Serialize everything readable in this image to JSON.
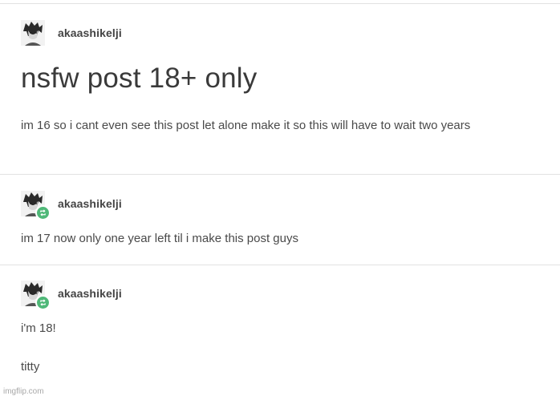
{
  "posts": [
    {
      "username": "akaashikelji",
      "title": "nsfw post 18+ only",
      "body": "im 16 so i cant even see this post let alone make it so this will have to wait two years",
      "reblogged": false
    },
    {
      "username": "akaashikelji",
      "body": "im 17 now only one year left til i make this post guys",
      "reblogged": true
    },
    {
      "username": "akaashikelji",
      "body": "i'm 18!",
      "body2": "titty",
      "reblogged": true
    }
  ],
  "watermark": "imgflip.com",
  "colors": {
    "reblog_badge": "#4fb878",
    "divider": "#e2e2e2"
  },
  "icons": {
    "avatar": "avatar-icon",
    "reblog": "reblog-icon"
  }
}
